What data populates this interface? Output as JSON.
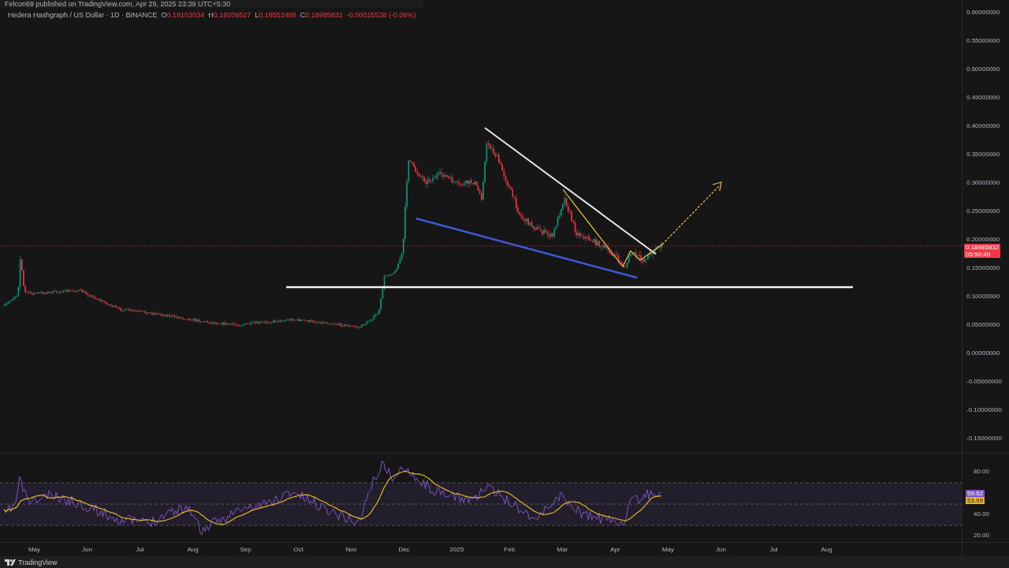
{
  "header": {
    "published": "Felcon69 published on TradingView.com, Apr 29, 2025 23:39 UTC+5:30",
    "symbol": "Hedera Hashgraph / US Dollar · 1D · BINANCE",
    "ohlc": [
      {
        "label": "O",
        "value": "0.19103034"
      },
      {
        "label": "H",
        "value": "0.19209527"
      },
      {
        "label": "L",
        "value": "0.18553468"
      },
      {
        "label": "C",
        "value": "0.18985832"
      }
    ],
    "change": "-0.00015538 (-0.08%)"
  },
  "price_axis": {
    "ticks": [
      "0.60000000",
      "0.55000000",
      "0.50000000",
      "0.45000000",
      "0.40000000",
      "0.35000000",
      "0.30000000",
      "0.25000000",
      "0.20000000",
      "0.15000000",
      "0.10000000",
      "0.05000000",
      "0.00000000",
      "-0.05000000",
      "-0.10000000",
      "-0.15000000"
    ],
    "last_price": "0.18985832",
    "countdown": "05:50:49"
  },
  "rsi_axis": {
    "ticks": [
      "80.00",
      "40.00",
      "20.00"
    ],
    "rsi_value": "59.52",
    "ma_value": "53.99"
  },
  "time_axis": [
    "May",
    "Jun",
    "Jul",
    "Aug",
    "Sep",
    "Oct",
    "Nov",
    "Dec",
    "2025",
    "Feb",
    "Mar",
    "Apr",
    "May",
    "Jun",
    "Jul",
    "Aug"
  ],
  "footer": {
    "brand": "TradingView"
  }
}
